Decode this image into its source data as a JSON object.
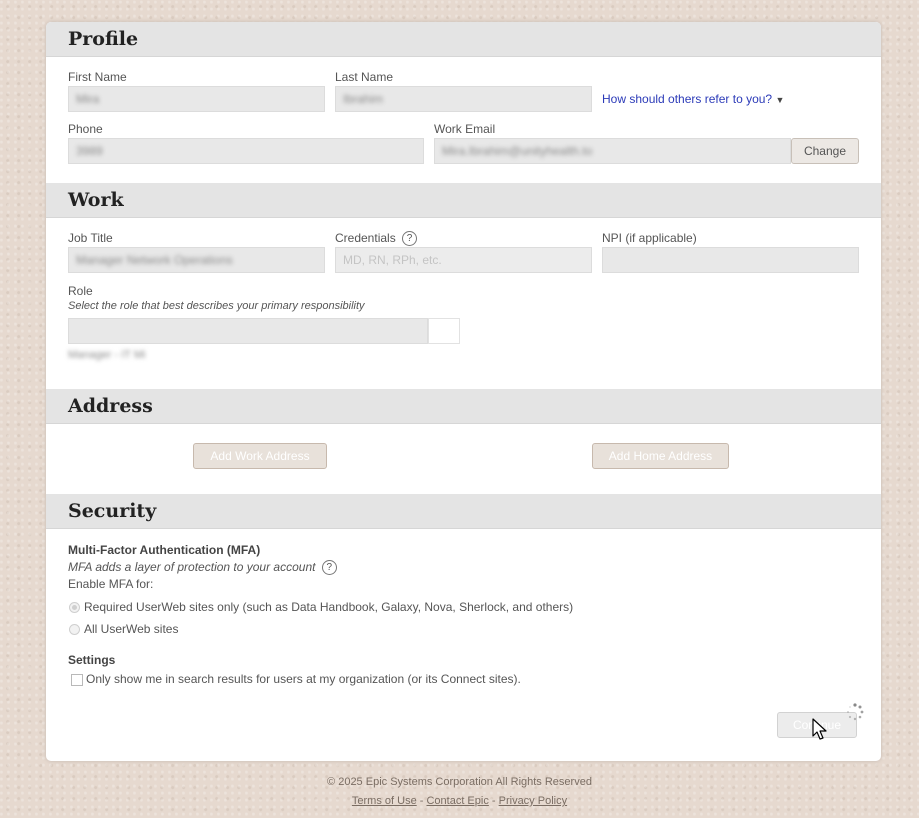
{
  "profile": {
    "title": "Profile",
    "first_name_label": "First Name",
    "first_name_value": "Mira",
    "last_name_label": "Last Name",
    "last_name_value": "Ibrahim",
    "refer_link": "How should others refer to you?",
    "phone_label": "Phone",
    "phone_value": "3989",
    "work_email_label": "Work Email",
    "work_email_value": "Mira.Ibrahim@unityhealth.to",
    "change_button": "Change"
  },
  "work": {
    "title": "Work",
    "job_title_label": "Job Title",
    "job_title_value": "Manager Network Operations",
    "credentials_label": "Credentials",
    "credentials_placeholder": "MD, RN, RPh, etc.",
    "npi_label": "NPI (if applicable)",
    "role_label": "Role",
    "role_hint": "Select the role that best describes your primary responsibility",
    "role_value": "",
    "tag_text": "Manager - IT Mi"
  },
  "address": {
    "title": "Address",
    "add_work_button": "Add Work Address",
    "add_home_button": "Add Home Address"
  },
  "security": {
    "title": "Security",
    "mfa_heading": "Multi-Factor Authentication (MFA)",
    "mfa_desc": "MFA adds a layer of protection to your account",
    "enable_label": "Enable MFA for:",
    "option_required": "Required UserWeb sites only (such as Data Handbook, Galaxy, Nova, Sherlock, and others)",
    "option_all": "All UserWeb sites",
    "settings_heading": "Settings",
    "search_option": "Only show me in search results for users at my organization (or its Connect sites).",
    "continue_button": "Continue"
  },
  "footer": {
    "copyright": "© 2025 Epic Systems Corporation All Rights Reserved",
    "terms": "Terms of Use",
    "contact": "Contact Epic",
    "privacy": "Privacy Policy",
    "sep": " - "
  }
}
